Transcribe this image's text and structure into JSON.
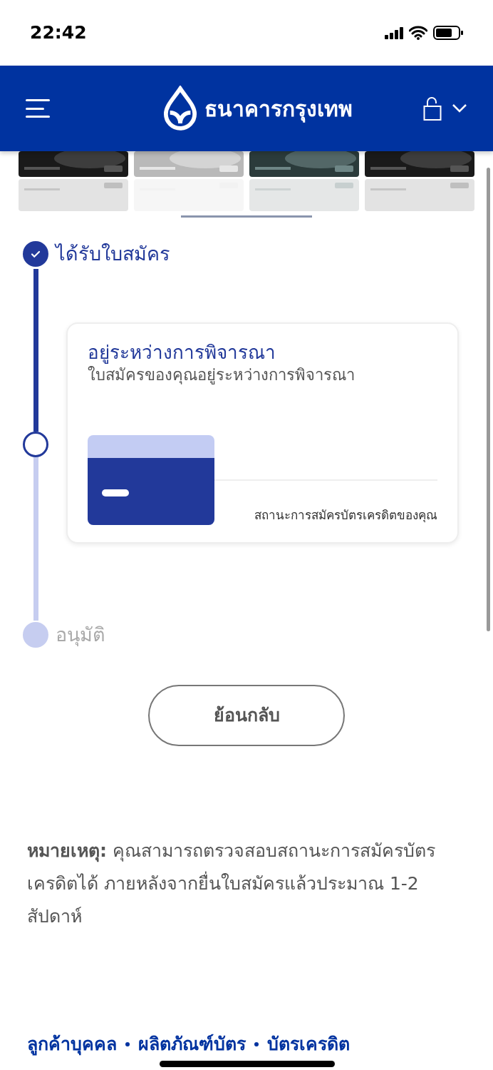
{
  "status_bar": {
    "time": "22:42"
  },
  "header": {
    "logo_text": "ธนาคารกรุงเทพ"
  },
  "card_strip": [
    {
      "kind": "picture"
    },
    {
      "kind": "picture"
    },
    {
      "kind": "picture"
    },
    {
      "kind": "picture"
    }
  ],
  "steps": [
    {
      "kind": "done",
      "label": "ได้รับใบสมัคร"
    },
    {
      "kind": "current",
      "card": {
        "title": "อยู่ระหว่างการพิจารณา",
        "subtitle": "ใบสมัครของคุณอยู่ระหว่างการพิจารณา",
        "caption": "สถานะการสมัครบัตรเครดิตของคุณ"
      }
    },
    {
      "kind": "pending",
      "label": "อนุมัติ"
    }
  ],
  "back_button": "ย้อนกลับ",
  "note": "**หมายเหตุ:** คุณสามารถตรวจสอบสถานะการสมัครบัตรเครดิตได้ ภายหลังจากยื่นใบสมัครแล้วประมาณ 1-2 สัปดาห์",
  "breadcrumbs": [
    "ลูกค้าบุคคล",
    "ผลิตภัณฑ์บัตร",
    "บัตรเครดิต"
  ]
}
